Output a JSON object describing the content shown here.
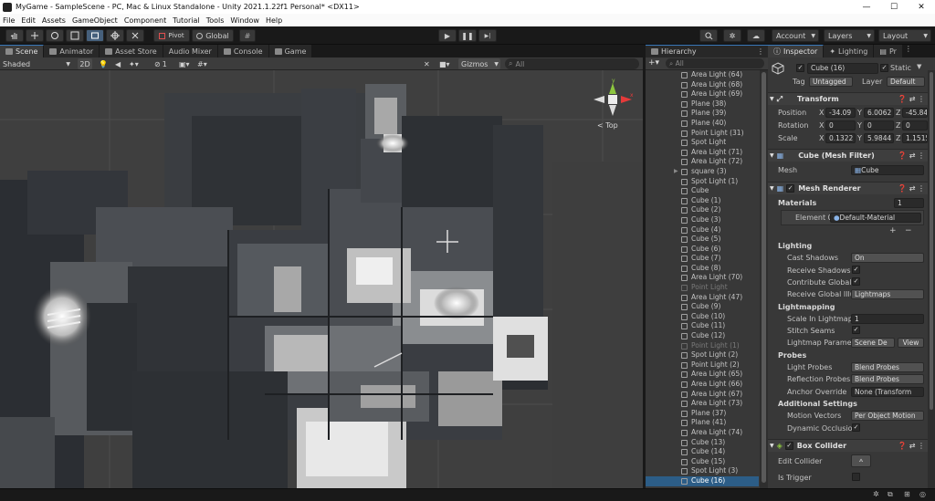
{
  "window": {
    "title": "MyGame - SampleScene - PC, Mac & Linux Standalone - Unity 2021.1.22f1 Personal* <DX11>",
    "minimize": "—",
    "maximize": "☐",
    "close": "✕"
  },
  "menu": [
    "File",
    "Edit",
    "Assets",
    "GameObject",
    "Component",
    "Tutorial",
    "Tools",
    "Window",
    "Help"
  ],
  "toolbar": {
    "pivot": "Pivot",
    "global": "Global",
    "play": "▶",
    "pause": "❚❚",
    "step": "▶|",
    "search": "🔍",
    "cloud": "☁",
    "account": "Account",
    "layers": "Layers",
    "layout": "Layout"
  },
  "scene_tabs": [
    "Scene",
    "Animator",
    "Asset Store",
    "Audio Mixer",
    "Console",
    "Game"
  ],
  "scene_toolbar": {
    "shading": "Shaded",
    "mode_2d": "2D",
    "gizmos": "Gizmos",
    "search_placeholder": "All",
    "fx_count": "1"
  },
  "gizmo": {
    "view_label": "< Top",
    "x": "x",
    "y": "y",
    "z": "z"
  },
  "hierarchy": {
    "title": "Hierarchy",
    "search_placeholder": "All",
    "items": [
      {
        "label": "Area Light (64)",
        "state": "normal"
      },
      {
        "label": "Area Light (68)",
        "state": "normal"
      },
      {
        "label": "Area Light (69)",
        "state": "normal"
      },
      {
        "label": "Plane (38)",
        "state": "normal"
      },
      {
        "label": "Plane (39)",
        "state": "normal"
      },
      {
        "label": "Plane (40)",
        "state": "normal"
      },
      {
        "label": "Point Light (31)",
        "state": "normal"
      },
      {
        "label": "Spot Light",
        "state": "normal"
      },
      {
        "label": "Area Light (71)",
        "state": "normal"
      },
      {
        "label": "Area Light (72)",
        "state": "normal"
      },
      {
        "label": "square (3)",
        "state": "parent"
      },
      {
        "label": "Spot Light (1)",
        "state": "normal"
      },
      {
        "label": "Cube",
        "state": "normal"
      },
      {
        "label": "Cube (1)",
        "state": "normal"
      },
      {
        "label": "Cube (2)",
        "state": "normal"
      },
      {
        "label": "Cube (3)",
        "state": "normal"
      },
      {
        "label": "Cube (4)",
        "state": "normal"
      },
      {
        "label": "Cube (5)",
        "state": "normal"
      },
      {
        "label": "Cube (6)",
        "state": "normal"
      },
      {
        "label": "Cube (7)",
        "state": "normal"
      },
      {
        "label": "Cube (8)",
        "state": "normal"
      },
      {
        "label": "Area Light (70)",
        "state": "normal"
      },
      {
        "label": "Point Light",
        "state": "disabled"
      },
      {
        "label": "Area Light (47)",
        "state": "normal"
      },
      {
        "label": "Cube (9)",
        "state": "normal"
      },
      {
        "label": "Cube (10)",
        "state": "normal"
      },
      {
        "label": "Cube (11)",
        "state": "normal"
      },
      {
        "label": "Cube (12)",
        "state": "normal"
      },
      {
        "label": "Point Light (1)",
        "state": "disabled"
      },
      {
        "label": "Spot Light (2)",
        "state": "normal"
      },
      {
        "label": "Point Light (2)",
        "state": "normal"
      },
      {
        "label": "Area Light (65)",
        "state": "normal"
      },
      {
        "label": "Area Light (66)",
        "state": "normal"
      },
      {
        "label": "Area Light (67)",
        "state": "normal"
      },
      {
        "label": "Area Light (73)",
        "state": "normal"
      },
      {
        "label": "Plane (37)",
        "state": "normal"
      },
      {
        "label": "Plane (41)",
        "state": "normal"
      },
      {
        "label": "Area Light (74)",
        "state": "normal"
      },
      {
        "label": "Cube (13)",
        "state": "normal"
      },
      {
        "label": "Cube (14)",
        "state": "normal"
      },
      {
        "label": "Cube (15)",
        "state": "normal"
      },
      {
        "label": "Spot Light (3)",
        "state": "normal"
      },
      {
        "label": "Cube (16)",
        "state": "selected"
      }
    ]
  },
  "inspector": {
    "tabs": [
      "Inspector",
      "Lighting",
      "Pr"
    ],
    "object_name": "Cube (16)",
    "static_label": "Static",
    "tag_label": "Tag",
    "tag_value": "Untagged",
    "layer_label": "Layer",
    "layer_value": "Default",
    "transform": {
      "title": "Transform",
      "position_label": "Position",
      "position": {
        "x": "-34.09",
        "y": "6.0062",
        "z": "-45.84"
      },
      "rotation_label": "Rotation",
      "rotation": {
        "x": "0",
        "y": "0",
        "z": "0"
      },
      "scale_label": "Scale",
      "scale": {
        "x": "0.1322",
        "y": "5.9844",
        "z": "1.1515"
      }
    },
    "mesh_filter": {
      "title": "Cube (Mesh Filter)",
      "mesh_label": "Mesh",
      "mesh_value": "Cube"
    },
    "mesh_renderer": {
      "title": "Mesh Renderer",
      "materials_label": "Materials",
      "materials_count": "1",
      "element_label": "Element 0",
      "element_value": "Default-Material",
      "lighting_header": "Lighting",
      "cast_shadows_label": "Cast Shadows",
      "cast_shadows_value": "On",
      "receive_shadows_label": "Receive Shadows",
      "contribute_gi_label": "Contribute Global",
      "receive_gi_label": "Receive Global Illu",
      "receive_gi_value": "Lightmaps",
      "lightmapping_header": "Lightmapping",
      "scale_lightmap_label": "Scale In Lightmap",
      "scale_lightmap_value": "1",
      "stitch_seams_label": "Stitch Seams",
      "lightmap_params_label": "Lightmap Paramet",
      "lightmap_params_value": "Scene De",
      "view_button": "View",
      "probes_header": "Probes",
      "light_probes_label": "Light Probes",
      "light_probes_value": "Blend Probes",
      "reflection_probes_label": "Reflection Probes",
      "reflection_probes_value": "Blend Probes",
      "anchor_override_label": "Anchor Override",
      "anchor_override_value": "None (Transform",
      "additional_header": "Additional Settings",
      "motion_vectors_label": "Motion Vectors",
      "motion_vectors_value": "Per Object Motion",
      "dynamic_occlusion_label": "Dynamic Occlusio"
    },
    "box_collider": {
      "title": "Box Collider",
      "edit_label": "Edit Collider",
      "trigger_label": "Is Trigger"
    }
  },
  "colors": {
    "accent": "#3a79bb",
    "selected_row": "#2c5d87",
    "gizmo_x": "#e53a3a",
    "gizmo_y": "#8dc63f",
    "gizmo_z": "#3a7de5"
  }
}
